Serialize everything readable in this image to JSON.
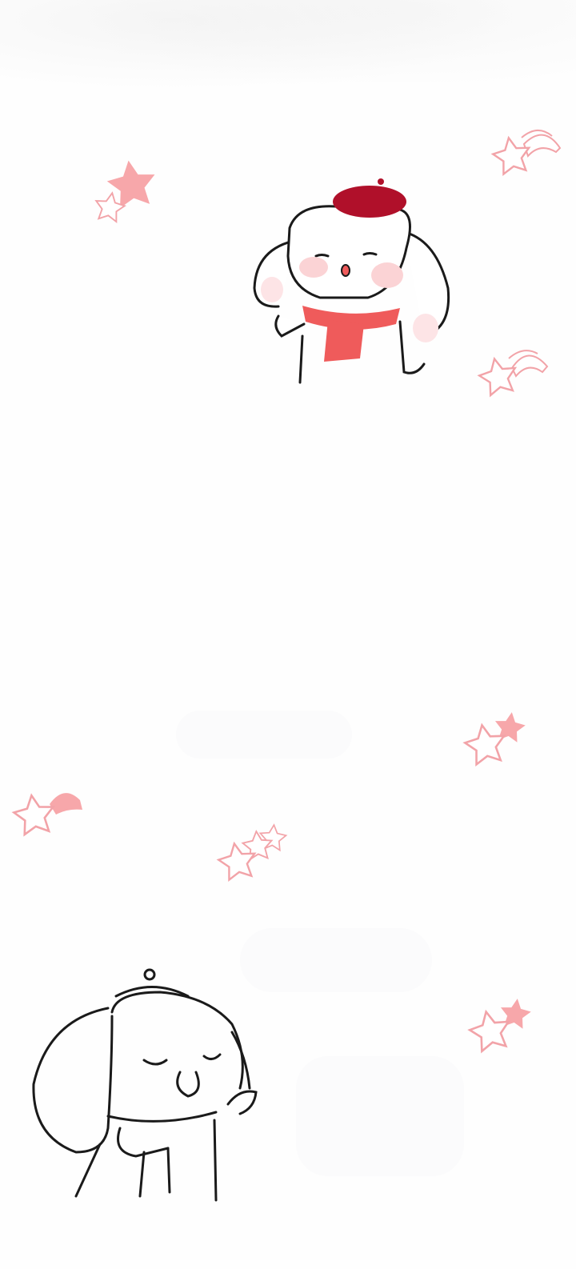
{
  "colors": {
    "background": "#fefefe",
    "star_outline": "#f2a3a8",
    "star_fill": "#f7a7aa",
    "beret": "#b0102a",
    "scarf": "#ef5b5b",
    "blush": "#fbd3d5",
    "ink": "#1a1a1a"
  },
  "illustration": {
    "top_character": "bunny-with-beret-and-scarf-colored",
    "bottom_character": "bunny-sleeping-line-art",
    "decorations": "shooting-star-icons"
  }
}
